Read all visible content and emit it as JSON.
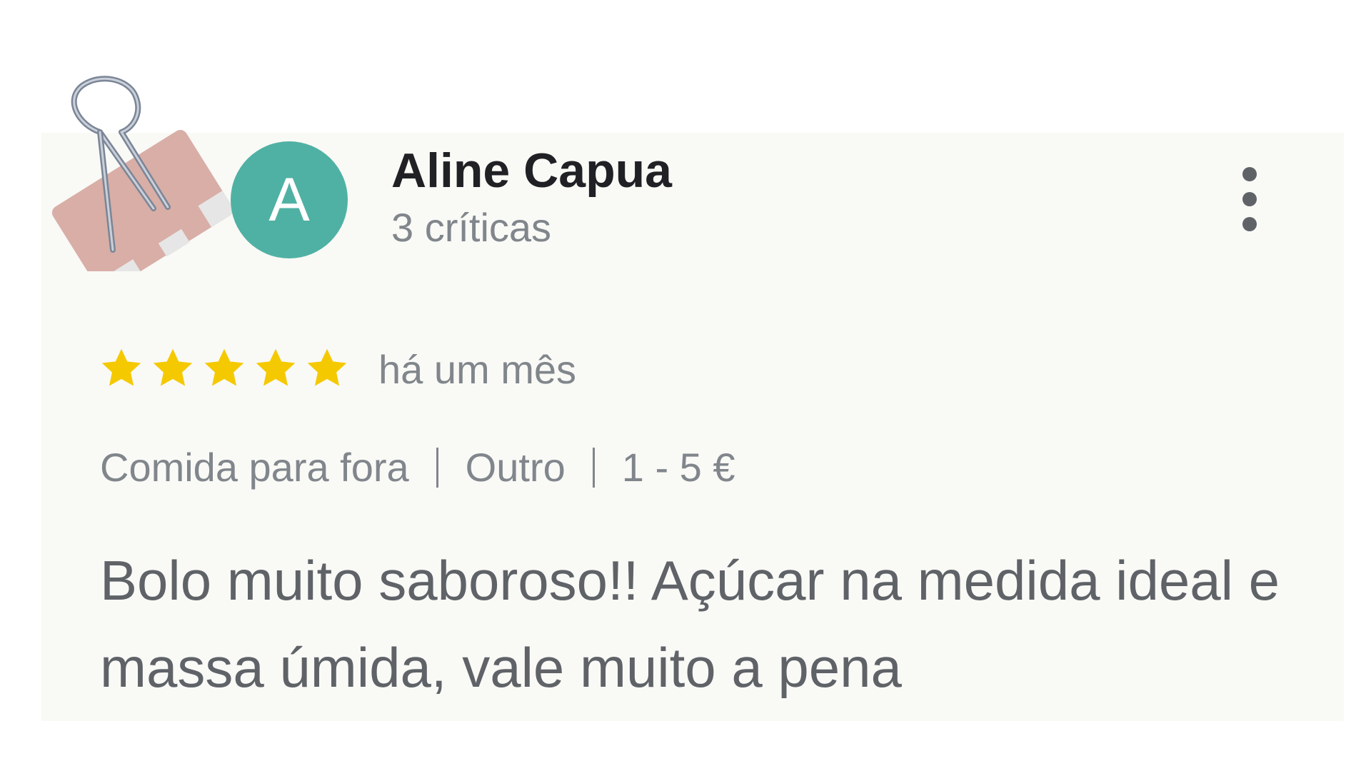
{
  "review": {
    "author": {
      "initial": "A",
      "name": "Aline Capua",
      "reviews_count": "3 críticas",
      "avatar_color": "#4fb1a3"
    },
    "rating": 5,
    "max_rating": 5,
    "time": "há um mês",
    "meta": [
      "Comida para fora",
      "Outro",
      "1 - 5 €"
    ],
    "text": "Bolo muito saboroso!! Açúcar na medida ideal e massa úmida, vale muito a pena",
    "star_color": "#f5c900",
    "more_icon": "more-vert-icon",
    "clip_icon": "binder-clip-icon"
  }
}
